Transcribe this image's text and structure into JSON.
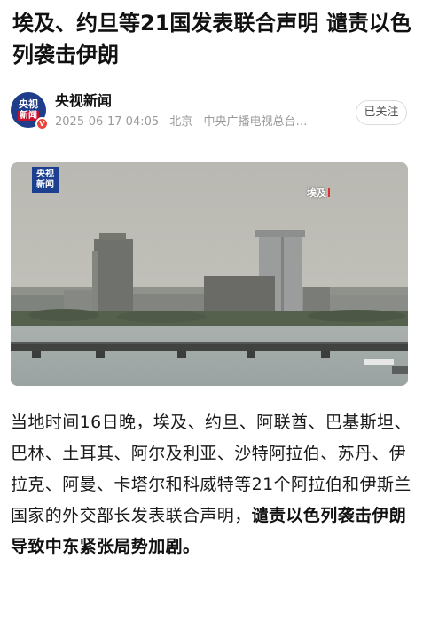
{
  "article": {
    "headline": "埃及、约旦等21国发表联合声明 谴责以色列袭击伊朗",
    "author": {
      "name": "央视新闻",
      "avatar_line1": "央视",
      "avatar_line2": "新闻",
      "date": "2025-06-17 04:05",
      "location": "北京",
      "org": "中央广播电视总台…",
      "follow_label": "已关注"
    },
    "video": {
      "logo_line1": "央视",
      "logo_line2": "新闻",
      "location_label": "埃及"
    },
    "body_plain": "当地时间16日晚，埃及、约旦、阿联酋、巴基斯坦、巴林、土耳其、阿尔及利亚、沙特阿拉伯、苏丹、伊拉克、阿曼、卡塔尔和科威特等21个阿拉伯和伊斯兰国家的外交部长发表联合声明，",
    "body_bold": "谴责以色列袭击伊朗导致中东紧张局势加剧。"
  },
  "colors": {
    "cctv_blue": "#1c3f8f",
    "verified_red": "#e8453c",
    "meta_gray": "#9a9a9a"
  }
}
